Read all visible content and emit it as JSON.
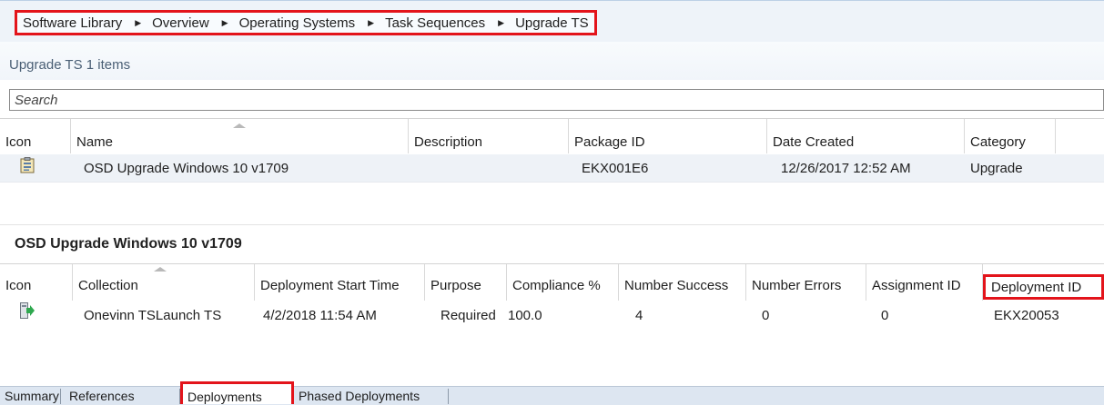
{
  "breadcrumb": [
    "Software Library",
    "Overview",
    "Operating Systems",
    "Task Sequences",
    "Upgrade TS"
  ],
  "items_title": "Upgrade TS 1 items",
  "search": {
    "placeholder": "Search"
  },
  "grid1": {
    "headers": [
      "Icon",
      "Name",
      "Description",
      "Package ID",
      "Date Created",
      "Category"
    ],
    "row": {
      "icon": "task-sequence-icon",
      "name": "OSD Upgrade Windows 10 v1709",
      "description": "",
      "package_id": "EKX001E6",
      "date_created": "12/26/2017 12:52 AM",
      "category": "Upgrade"
    }
  },
  "detail_title": "OSD Upgrade Windows 10 v1709",
  "grid2": {
    "headers": [
      "Icon",
      "Collection",
      "Deployment Start Time",
      "Purpose",
      "Compliance %",
      "Number Success",
      "Number Errors",
      "Assignment ID",
      "Deployment ID"
    ],
    "row": {
      "icon": "deployment-icon",
      "collection": "Onevinn TSLaunch TS",
      "start_time": "4/2/2018 11:54 AM",
      "purpose": "Required",
      "compliance": "100.0",
      "success": "4",
      "errors": "0",
      "assignment_id": "0",
      "deployment_id": "EKX20053"
    }
  },
  "tabs": [
    "Summary",
    "References",
    "Deployments",
    "Phased Deployments"
  ],
  "active_tab": "Deployments",
  "colors": {
    "highlight": "#e3141b",
    "selected_row": "#eef2f7",
    "tabbar": "#dde6f1"
  }
}
